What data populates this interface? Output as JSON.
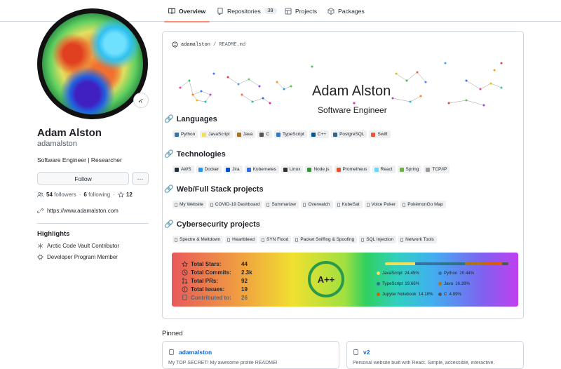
{
  "tabs": [
    {
      "label": "Overview",
      "icon": "book-icon",
      "active": true
    },
    {
      "label": "Repositories",
      "icon": "repo-icon",
      "count": "39"
    },
    {
      "label": "Projects",
      "icon": "table-icon"
    },
    {
      "label": "Packages",
      "icon": "package-icon"
    }
  ],
  "profile": {
    "name": "Adam Alston",
    "login": "adamalston",
    "bio": "Software Engineer | Researcher",
    "follow_label": "Follow",
    "more_label": "···",
    "followers_count": "54",
    "followers_label": "followers",
    "following_count": "6",
    "following_label": "following",
    "stars_count": "12",
    "website": "https://www.adamalston.com"
  },
  "highlights": {
    "title": "Highlights",
    "items": [
      {
        "label": "Arctic Code Vault Contributor",
        "icon": "snowflake-icon"
      },
      {
        "label": "Developer Program Member",
        "icon": "cpu-icon"
      }
    ]
  },
  "readme": {
    "owner": "adamalston",
    "slash": "/",
    "file": "README.md",
    "hero_name": "Adam Alston",
    "hero_subtitle": "Software Engineer",
    "sections": {
      "languages": {
        "title": "Languages",
        "badges": [
          {
            "label": "Python",
            "color": "#3572A5"
          },
          {
            "label": "JavaScript",
            "color": "#f1e05a"
          },
          {
            "label": "Java",
            "color": "#b07219"
          },
          {
            "label": "C",
            "color": "#555555"
          },
          {
            "label": "TypeScript",
            "color": "#3178c6"
          },
          {
            "label": "C++",
            "color": "#00599C"
          },
          {
            "label": "PostgreSQL",
            "color": "#336791"
          },
          {
            "label": "Swift",
            "color": "#F05138"
          }
        ]
      },
      "technologies": {
        "title": "Technologies",
        "badges": [
          {
            "label": "AWS",
            "color": "#232F3E"
          },
          {
            "label": "Docker",
            "color": "#2496ED"
          },
          {
            "label": "Jira",
            "color": "#0052CC"
          },
          {
            "label": "Kubernetes",
            "color": "#326CE5"
          },
          {
            "label": "Linux",
            "color": "#333333"
          },
          {
            "label": "Node.js",
            "color": "#339933"
          },
          {
            "label": "Prometheus",
            "color": "#E6522C"
          },
          {
            "label": "React",
            "color": "#61DAFB"
          },
          {
            "label": "Spring",
            "color": "#6DB33F"
          },
          {
            "label": "TCP/IP",
            "color": "#999999"
          }
        ]
      },
      "webprojects": {
        "title": "Web/Full Stack projects",
        "badges": [
          {
            "label": "My Website"
          },
          {
            "label": "COVID-19 Dashboard"
          },
          {
            "label": "Summarizer"
          },
          {
            "label": "Overwatch"
          },
          {
            "label": "KubeSat"
          },
          {
            "label": "Voice Poker"
          },
          {
            "label": "PokémonGo Map"
          }
        ]
      },
      "security": {
        "title": "Cybersecurity projects",
        "badges": [
          {
            "label": "Spectre & Meltdown"
          },
          {
            "label": "Heartbleed"
          },
          {
            "label": "SYN Flood"
          },
          {
            "label": "Packet Sniffing & Spoofing"
          },
          {
            "label": "SQL Injection"
          },
          {
            "label": "Network Tools"
          }
        ]
      }
    },
    "stats": {
      "rows": [
        {
          "label": "Total Stars:",
          "value": "44",
          "icon": "star-icon"
        },
        {
          "label": "Total Commits:",
          "value": "2.3k",
          "icon": "clock-icon"
        },
        {
          "label": "Total PRs:",
          "value": "92",
          "icon": "pr-icon"
        },
        {
          "label": "Total Issues:",
          "value": "19",
          "icon": "issue-icon"
        },
        {
          "label": "Contributed to:",
          "value": "26",
          "icon": "repo-icon"
        }
      ],
      "grade": "A++"
    },
    "top_langs": [
      {
        "name": "JavaScript",
        "percent": "24.45%",
        "color": "#f1e05a",
        "fraction": 0.2445
      },
      {
        "name": "Python",
        "percent": "20.44%",
        "color": "#3572A5",
        "fraction": 0.2044
      },
      {
        "name": "TypeScript",
        "percent": "19.66%",
        "color": "#2b7489",
        "fraction": 0.1966
      },
      {
        "name": "Java",
        "percent": "16.39%",
        "color": "#b07219",
        "fraction": 0.1639
      },
      {
        "name": "Jupyter Notebook",
        "percent": "14.18%",
        "color": "#DA5B0B",
        "fraction": 0.1418
      },
      {
        "name": "C",
        "percent": "4.89%",
        "color": "#555555",
        "fraction": 0.0489
      }
    ]
  },
  "pinned": {
    "title": "Pinned",
    "items": [
      {
        "name": "adamalston",
        "desc": "My TOP SECRET! My awesome profile README!"
      },
      {
        "name": "v2",
        "desc": "Personal website built with React. Simple, accessible, interactive."
      }
    ]
  }
}
